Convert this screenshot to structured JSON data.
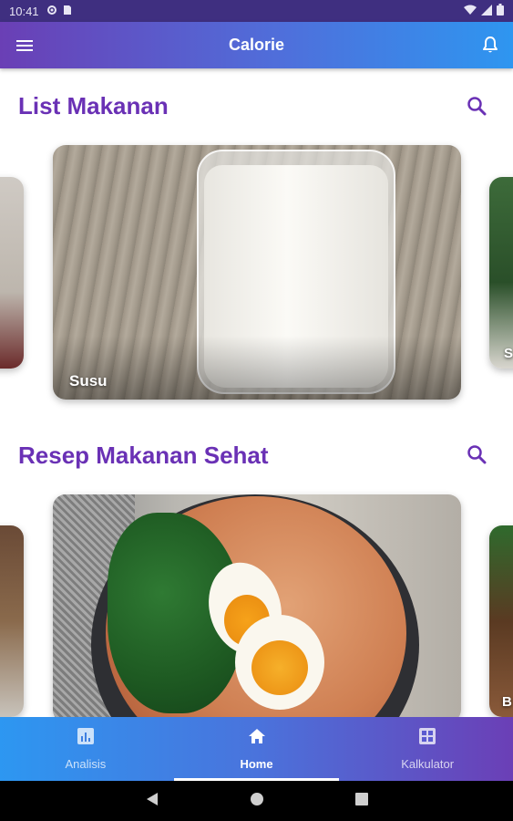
{
  "status_bar": {
    "time": "10:41",
    "icons": [
      "gear-icon",
      "sim-icon",
      "wifi-icon",
      "signal-icon",
      "battery-icon"
    ]
  },
  "app_bar": {
    "title": "Calorie",
    "left_icon": "hamburger-menu-icon",
    "right_icon": "bell-icon"
  },
  "sections": [
    {
      "title": "List Makanan",
      "search_icon": "search-icon",
      "cards": [
        {
          "label": "Susu",
          "image": "milk-glass"
        }
      ],
      "peek_right_label": "S"
    },
    {
      "title": "Resep Makanan Sehat",
      "search_icon": "search-icon",
      "cards": [
        {
          "label": "",
          "image": "oatmeal-egg-greens-bowl"
        }
      ],
      "peek_right_label": "B"
    }
  ],
  "bottom_nav": {
    "items": [
      {
        "label": "Analisis",
        "icon": "chart-icon",
        "active": false
      },
      {
        "label": "Home",
        "icon": "home-icon",
        "active": true
      },
      {
        "label": "Kalkulator",
        "icon": "calculator-icon",
        "active": false
      }
    ]
  },
  "system_nav": [
    "back-icon",
    "home-circle-icon",
    "recents-icon"
  ],
  "colors": {
    "accent": "#6a31b5",
    "gradient_start": "#6a3fb5",
    "gradient_end": "#2e96f0"
  }
}
